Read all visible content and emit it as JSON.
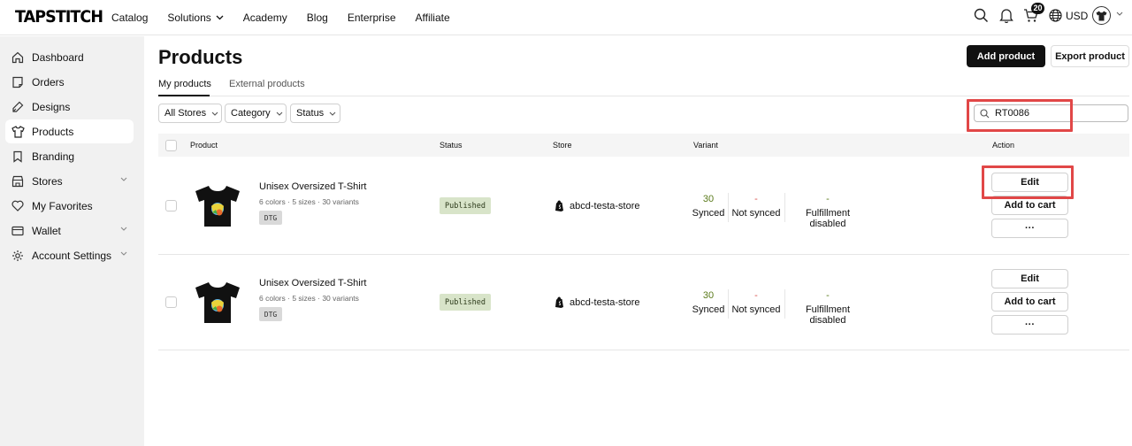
{
  "brand": {
    "logo_text": "TAPSTITCH"
  },
  "nav": {
    "items": [
      {
        "label": "Catalog",
        "has_dropdown": false
      },
      {
        "label": "Solutions",
        "has_dropdown": true
      },
      {
        "label": "Academy",
        "has_dropdown": false
      },
      {
        "label": "Blog",
        "has_dropdown": false
      },
      {
        "label": "Enterprise",
        "has_dropdown": false
      },
      {
        "label": "Affiliate",
        "has_dropdown": false
      }
    ],
    "cart_count": "20",
    "currency": "USD",
    "icons": [
      "search-icon",
      "bell-icon",
      "cart-icon",
      "globe-icon",
      "avatar-shirt-icon"
    ]
  },
  "sidebar": {
    "items": [
      {
        "label": "Dashboard",
        "icon": "home-icon",
        "active": false,
        "has_chevron": false
      },
      {
        "label": "Orders",
        "icon": "orders-icon",
        "active": false,
        "has_chevron": false
      },
      {
        "label": "Designs",
        "icon": "pen-icon",
        "active": false,
        "has_chevron": false
      },
      {
        "label": "Products",
        "icon": "shirt-icon",
        "active": true,
        "has_chevron": false
      },
      {
        "label": "Branding",
        "icon": "bookmark-icon",
        "active": false,
        "has_chevron": false
      },
      {
        "label": "Stores",
        "icon": "store-icon",
        "active": false,
        "has_chevron": true
      },
      {
        "label": "My Favorites",
        "icon": "heart-icon",
        "active": false,
        "has_chevron": false
      },
      {
        "label": "Wallet",
        "icon": "wallet-icon",
        "active": false,
        "has_chevron": true
      },
      {
        "label": "Account Settings",
        "icon": "gear-icon",
        "active": false,
        "has_chevron": true
      }
    ]
  },
  "main": {
    "title": "Products",
    "add_button": "Add product",
    "export_button": "Export product",
    "tabs": [
      {
        "label": "My products",
        "active": true
      },
      {
        "label": "External products",
        "active": false
      }
    ],
    "filters": [
      {
        "label": "All Stores"
      },
      {
        "label": "Category"
      },
      {
        "label": "Status"
      }
    ],
    "search": {
      "value": "RT0086",
      "placeholder": ""
    },
    "table": {
      "headers": {
        "product": "Product",
        "status": "Status",
        "store": "Store",
        "variant": "Variant",
        "action": "Action"
      },
      "rows": [
        {
          "name": "Unisex Oversized T-Shirt",
          "details": "6 colors · 5 sizes · 30 variants",
          "tag": "DTG",
          "status": "Published",
          "store": "abcd-testa-store",
          "synced": "30",
          "synced_label": "Synced",
          "not_synced": "-",
          "not_synced_label": "Not synced",
          "fulfillment": "-",
          "fulfillment_label": "Fulfillment disabled",
          "actions": {
            "edit": "Edit",
            "add_to_cart": "Add to cart",
            "more": "···"
          }
        },
        {
          "name": "Unisex Oversized T-Shirt",
          "details": "6 colors · 5 sizes · 30 variants",
          "tag": "DTG",
          "status": "Published",
          "store": "abcd-testa-store",
          "synced": "30",
          "synced_label": "Synced",
          "not_synced": "-",
          "not_synced_label": "Not synced",
          "fulfillment": "-",
          "fulfillment_label": "Fulfillment disabled",
          "actions": {
            "edit": "Edit",
            "add_to_cart": "Add to cart",
            "more": "···"
          }
        }
      ]
    }
  },
  "colors": {
    "accent_dark": "#111111",
    "highlight": "#e14747",
    "synced": "#5a7a1a",
    "not_synced": "#d9534f",
    "fulfillment": "#5a7a1a",
    "published_bg": "#d8e4c9"
  }
}
